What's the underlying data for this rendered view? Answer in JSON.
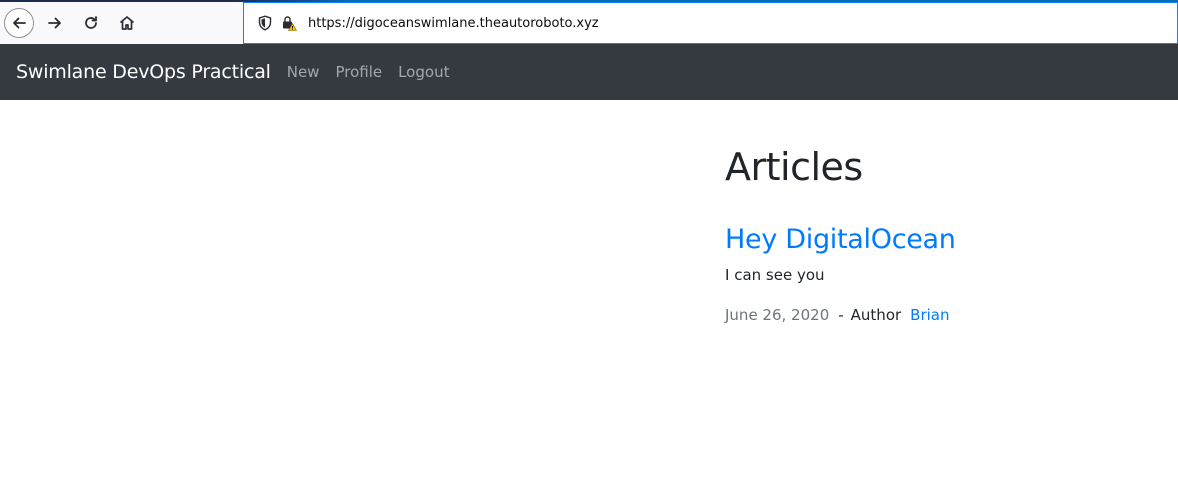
{
  "browser": {
    "url": "https://digoceanswimlane.theautoroboto.xyz",
    "icons": [
      "back-arrow-icon",
      "forward-arrow-icon",
      "reload-icon",
      "home-icon",
      "shield-icon",
      "lock-warning-icon"
    ]
  },
  "navbar": {
    "brand": "Swimlane DevOps Practical",
    "links": [
      {
        "label": "New"
      },
      {
        "label": "Profile"
      },
      {
        "label": "Logout"
      }
    ]
  },
  "main": {
    "heading": "Articles",
    "articles": [
      {
        "title": "Hey DigitalOcean",
        "body": "I can see you",
        "date": "June 26, 2020",
        "separator": "-",
        "author_label": "Author",
        "author": "Brian"
      }
    ]
  },
  "colors": {
    "navbar_bg": "#343a40",
    "link_blue": "#007bff",
    "muted": "#6c757d",
    "text": "#212529"
  }
}
